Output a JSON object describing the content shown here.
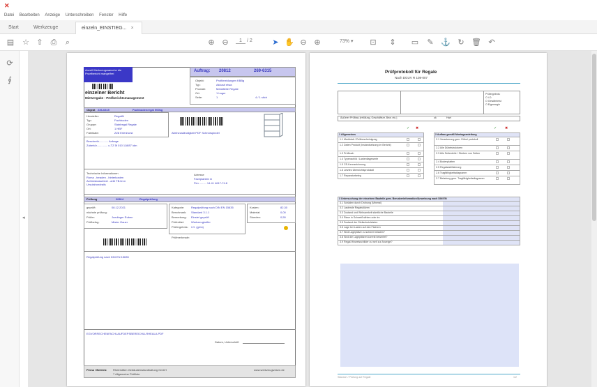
{
  "app": {
    "icon_glyph": "✕",
    "menu": [
      "Datei",
      "Bearbeiten",
      "Anzeige",
      "Unterschreiben",
      "Fenster",
      "Hilfe"
    ],
    "tabs": [
      {
        "label": "Start",
        "active": false
      },
      {
        "label": "Werkzeuge",
        "active": false
      },
      {
        "label": "einzeln_EINSTIEG...",
        "active": true
      }
    ],
    "tab_close": "×"
  },
  "toolbar": {
    "page_current": "1",
    "page_total": "/ 2",
    "zoom": "73%",
    "icons": [
      "save-icon",
      "bookmark-star-icon",
      "upload-icon",
      "print-icon",
      "search-icon",
      "page-up-icon",
      "page-down-icon",
      "select-cursor-icon",
      "hand-tool-icon",
      "zoom-out-icon",
      "zoom-in-icon",
      "fit-page-icon",
      "scroll-mode-icon",
      "comment-icon",
      "pen-icon",
      "sign-icon",
      "rotate-icon",
      "delete-icon",
      "undo-icon"
    ]
  },
  "page1": {
    "header": {
      "logo_line1": "Anzeil Werkzeugwaesche die",
      "logo_line2": "Pruefbericht mangelfrei",
      "title": "einzelner Bericht",
      "subtitle": "Mietvergabe - Prüfberichtsmanagement",
      "auftrag_label": "Auftrag:",
      "auftrag_no": "20812",
      "auftrag_ref": "269-6315",
      "fields": [
        {
          "label": "Objekt:",
          "value": "Profilmeldungen KBBg"
        },
        {
          "label": "Typ:",
          "value": "Akkusit etwa"
        },
        {
          "label": "Produkt:",
          "value": "Metallteile Regale"
        },
        {
          "label": "Ort:",
          "value": "1 Lager"
        },
        {
          "label": "Seite:",
          "value": "1",
          "extra": "4 / 1 stich"
        }
      ]
    },
    "section_obj": {
      "label": "Objekt",
      "code": "236-6315",
      "name": "Fachbodenregal 500kg",
      "fields": [
        {
          "label": "Hersteller:",
          "value": "Regalfit"
        },
        {
          "label": "Typ:",
          "value": "Fachboden"
        },
        {
          "label": "Gruppe:",
          "value": "Stahlregal Regale"
        },
        {
          "label": "Ort:",
          "value": "1 HBF"
        },
        {
          "label": "Fabrikate:",
          "value": "ZZ8 Erlenhorst"
        }
      ],
      "note": "Alleinzuständigkeit PDF Schnürspindel",
      "note_lines": [
        "Beschreib............ Anfrage",
        "Zubehör.............. u.TZ 5f 010 118/87 idm"
      ]
    },
    "contacts": {
      "left_label": "Technische Informationen",
      "left_lines": [
        "Roma - teraden - hinterkosten",
        "Achimsbasweizei - arbt TB.tel-n",
        "Ursulahondrails"
      ],
      "right_label": "Adresse",
      "right_lines": [
        "Fachplanbin m",
        "Fim ......... 14.41 4617-74.8"
      ]
    },
    "pruefung": {
      "label": "Prüfung",
      "number": "20814",
      "name": "Regalprüfung",
      "fields_left": [
        {
          "label": "geprüft:",
          "value": "08.12.2021"
        },
        {
          "label": "nächste prüfung:",
          "value": ""
        },
        {
          "label": "Prüfer:",
          "value": "Juedinger Ruben"
        },
        {
          "label": "Prüfbefug:",
          "value": "Mister Gauer"
        }
      ],
      "fields_mid": [
        {
          "label": "Kategorie:",
          "value": "Regalprüfung nach DIN EN 15635"
        },
        {
          "label": "Benchmark:",
          "value": "Standard 3.1.1"
        },
        {
          "label": "Bemerkung:",
          "value": "Einstel geprüft"
        },
        {
          "label": "Prüfmittel:",
          "value": "Werkzeugkoffer"
        },
        {
          "label": "Prüfergebnis:",
          "value": "i.O. (grün)"
        }
      ],
      "fields_right": [
        {
          "label": "Kosten:",
          "value": "82,30"
        },
        {
          "label": "Material:",
          "value": "0,00"
        },
        {
          "label": "Stunden:",
          "value": "0,50"
        }
      ],
      "remarks_label": "Prüfmerkmale:",
      "remarks": "Regalprüfung nach DIN EN 15635",
      "status_color": "#e8b400"
    },
    "footer": {
      "link": "EGVORRECHENFACHLAUFDEPSBEREICHLLRHEALA.PDF",
      "sign_label": "Datum, Unterschrift",
      "company_label": "Firma / Betrieb:",
      "company_name": "Rheinhäfen Gebäudeinstandhaltung GmbH",
      "company_sub": "7 Allgemeine Prüfliste",
      "website": "www.werkzeugwesen.de"
    },
    "colors": {
      "brand": "#3b38c7",
      "header_bg": "#c7c6ee"
    }
  },
  "page2": {
    "title": "Prüfprotokoll für Regale",
    "subtitle": "Nach DGUV R 108-007",
    "status_lines": [
      "Prüfergebnis:",
      "O   i.O.",
      "O   Gewährleist",
      "O   Eigenregie"
    ],
    "inspection_line": "Äußerer Prüfbau (erfüllung, Geschäftsnr. Bew. etc.)",
    "inspection_ok": "ok",
    "inspection_nicht": "Hart",
    "check_mark": "✓",
    "cross_mark": "✖",
    "left_title": "1 Allgemeines",
    "left_items": [
      "1.1 Merkblatt / Prüfbescheinigung",
      "1.2 Daten Produkt (Instandsetzung im Bericht)",
      "1.3 Prüfbuch",
      "1.4 Typenschild / Lastentlagewerte",
      "1.5 CE-Kennzeichnung",
      "1.6 Letztes Übersichtsprotokoll",
      "1.7 Reparaturbeleg"
    ],
    "right_title": "2 Aufbau gemäß Montageanleitung",
    "right_items": [
      "2.1 Verankerung gem. Dübel protokoll",
      "2.2 Alle Dübelstrukturen",
      "2.3 Alle Seitenteile / Streben von Seiten",
      "2.4 Bodenplatten",
      "2.5 Regalstabilisierung",
      "2.6 Tragfähigkeitsdiagramm",
      "2.7 Beladung gem. Tragfähigkeitsdiagramm"
    ],
    "section3_title": "3 Untersuchung der einzelnen Bauteile gem. Benutzerinformation/Anweisung nach DIN EN",
    "section3_items": [
      "3.1 Schäden durch Drohung (Mineral)",
      "3.2 Lastende Regalstützen",
      "3.3 Zustand und Wirksamkeit sämtliche Bauteile",
      "3.4 Risse in Schweißnähten oder im",
      "3.5 Zustand der Gleitschutzleisten",
      "3.6 Lage bei Lasten auf den Fächern",
      "3.7 Sind Lageplätze zu schwer beladen?",
      "3.8 Sind die Lageplätzen korrekt bewertet?",
      "3.9 Regal-Hinweisschilder zu weit zur Anzeige?"
    ],
    "footer_left": "Standort / Prüfung auf Regale",
    "footer_right": "1/2",
    "colors": {
      "accent_line": "#4aa6c8",
      "note_area": "#dde3f8"
    }
  }
}
